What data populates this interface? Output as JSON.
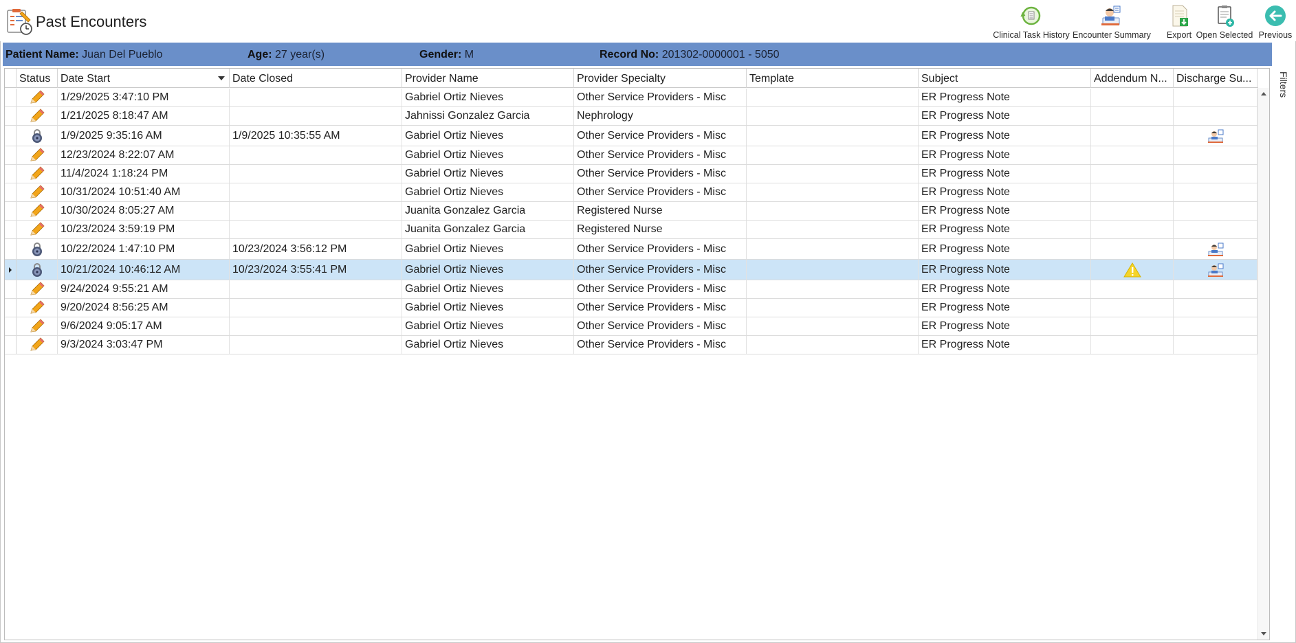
{
  "window": {
    "title": "Past Encounters"
  },
  "toolbar": {
    "buttons": [
      {
        "label": "Clinical Task History",
        "icon": "clinical-task-history-icon"
      },
      {
        "label": "Encounter Summary",
        "icon": "encounter-summary-icon"
      },
      {
        "label": "Export",
        "icon": "export-icon"
      },
      {
        "label": "Open Selected",
        "icon": "open-selected-icon"
      },
      {
        "label": "Previous",
        "icon": "back-arrow-icon"
      }
    ]
  },
  "patient": {
    "name_label": "Patient Name:",
    "name": "Juan Del Pueblo",
    "age_label": "Age:",
    "age": "27 year(s)",
    "gender_label": "Gender:",
    "gender": "M",
    "record_label": "Record No:",
    "record": "201302-0000001 - 5050"
  },
  "colors": {
    "patient_bar": "#6a8fc9",
    "selected_row": "#cce4f7",
    "pencil": "#f2a51a",
    "warning": "#f5d42a"
  },
  "side_tab": {
    "label": "Filters"
  },
  "grid": {
    "columns": [
      "Status",
      "Date Start",
      "Date Closed",
      "Provider Name",
      "Provider Specialty",
      "Template",
      "Subject",
      "Addendum N...",
      "Discharge Su..."
    ],
    "sort_column": "Date Start",
    "rows": [
      {
        "status": "edit",
        "date_start": "1/29/2025 3:47:10 PM",
        "date_closed": "",
        "provider": "Gabriel Ortiz Nieves",
        "specialty": "Other Service Providers - Misc",
        "template": "",
        "subject": "ER Progress Note",
        "addendum": "",
        "discharge": false
      },
      {
        "status": "edit",
        "date_start": "1/21/2025 8:18:47 AM",
        "date_closed": "",
        "provider": "Jahnissi Gonzalez Garcia",
        "specialty": "Nephrology",
        "template": "",
        "subject": "ER Progress Note",
        "addendum": "",
        "discharge": false
      },
      {
        "status": "locked",
        "date_start": "1/9/2025 9:35:16 AM",
        "date_closed": "1/9/2025 10:35:55 AM",
        "provider": "Gabriel Ortiz Nieves",
        "specialty": "Other Service Providers - Misc",
        "template": "",
        "subject": "ER Progress Note",
        "addendum": "",
        "discharge": true
      },
      {
        "status": "edit",
        "date_start": "12/23/2024 8:22:07 AM",
        "date_closed": "",
        "provider": "Gabriel Ortiz Nieves",
        "specialty": "Other Service Providers - Misc",
        "template": "",
        "subject": "ER Progress Note",
        "addendum": "",
        "discharge": false
      },
      {
        "status": "edit",
        "date_start": "11/4/2024 1:18:24 PM",
        "date_closed": "",
        "provider": "Gabriel Ortiz Nieves",
        "specialty": "Other Service Providers - Misc",
        "template": "",
        "subject": "ER Progress Note",
        "addendum": "",
        "discharge": false
      },
      {
        "status": "edit",
        "date_start": "10/31/2024 10:51:40 AM",
        "date_closed": "",
        "provider": "Gabriel Ortiz Nieves",
        "specialty": "Other Service Providers - Misc",
        "template": "",
        "subject": "ER Progress Note",
        "addendum": "",
        "discharge": false
      },
      {
        "status": "edit",
        "date_start": "10/30/2024 8:05:27 AM",
        "date_closed": "",
        "provider": "Juanita Gonzalez Garcia",
        "specialty": "Registered Nurse",
        "template": "",
        "subject": "ER Progress Note",
        "addendum": "",
        "discharge": false
      },
      {
        "status": "edit",
        "date_start": "10/23/2024 3:59:19 PM",
        "date_closed": "",
        "provider": "Juanita Gonzalez Garcia",
        "specialty": "Registered Nurse",
        "template": "",
        "subject": "ER Progress Note",
        "addendum": "",
        "discharge": false
      },
      {
        "status": "locked",
        "date_start": "10/22/2024 1:47:10 PM",
        "date_closed": "10/23/2024 3:56:12 PM",
        "provider": "Gabriel Ortiz Nieves",
        "specialty": "Other Service Providers - Misc",
        "template": "",
        "subject": "ER Progress Note",
        "addendum": "",
        "discharge": true
      },
      {
        "status": "locked",
        "date_start": "10/21/2024 10:46:12 AM",
        "date_closed": "10/23/2024 3:55:41 PM",
        "provider": "Gabriel Ortiz Nieves",
        "specialty": "Other Service Providers - Misc",
        "template": "",
        "subject": "ER Progress Note",
        "addendum": "warning",
        "discharge": true,
        "selected": true
      },
      {
        "status": "edit",
        "date_start": "9/24/2024 9:55:21 AM",
        "date_closed": "",
        "provider": "Gabriel Ortiz Nieves",
        "specialty": "Other Service Providers - Misc",
        "template": "",
        "subject": "ER Progress Note",
        "addendum": "",
        "discharge": false
      },
      {
        "status": "edit",
        "date_start": "9/20/2024 8:56:25 AM",
        "date_closed": "",
        "provider": "Gabriel Ortiz Nieves",
        "specialty": "Other Service Providers - Misc",
        "template": "",
        "subject": "ER Progress Note",
        "addendum": "",
        "discharge": false
      },
      {
        "status": "edit",
        "date_start": "9/6/2024 9:05:17 AM",
        "date_closed": "",
        "provider": "Gabriel Ortiz Nieves",
        "specialty": "Other Service Providers - Misc",
        "template": "",
        "subject": "ER Progress Note",
        "addendum": "",
        "discharge": false
      },
      {
        "status": "edit",
        "date_start": "9/3/2024 3:03:47 PM",
        "date_closed": "",
        "provider": "Gabriel Ortiz Nieves",
        "specialty": "Other Service Providers - Misc",
        "template": "",
        "subject": "ER Progress Note",
        "addendum": "",
        "discharge": false
      }
    ]
  }
}
